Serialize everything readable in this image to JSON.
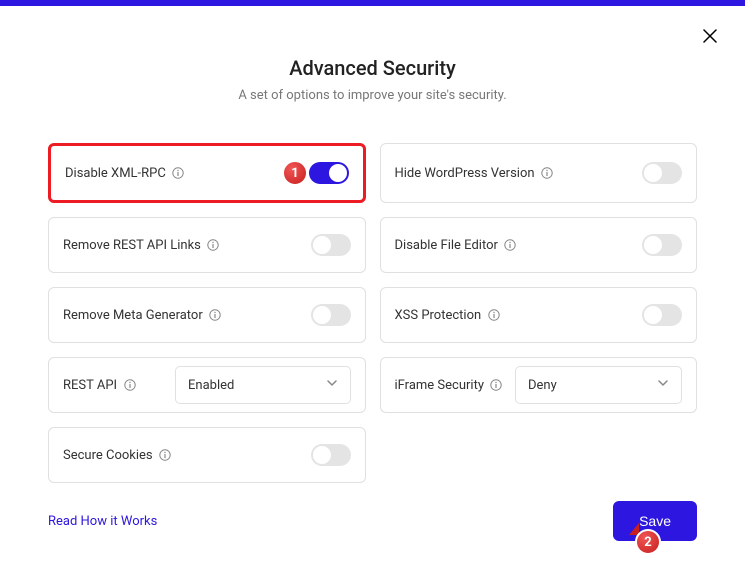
{
  "header": {
    "title": "Advanced Security",
    "subtitle": "A set of options to improve your site's security."
  },
  "options": {
    "disable_xmlrpc": {
      "label": "Disable XML-RPC",
      "on": true
    },
    "hide_wp_version": {
      "label": "Hide WordPress Version",
      "on": false
    },
    "remove_rest_links": {
      "label": "Remove REST API Links",
      "on": false
    },
    "disable_file_editor": {
      "label": "Disable File Editor",
      "on": false
    },
    "remove_meta_generator": {
      "label": "Remove Meta Generator",
      "on": false
    },
    "xss_protection": {
      "label": "XSS Protection",
      "on": false
    },
    "rest_api": {
      "label": "REST API",
      "value": "Enabled"
    },
    "iframe_security": {
      "label": "iFrame Security",
      "value": "Deny"
    },
    "secure_cookies": {
      "label": "Secure Cookies",
      "on": false
    }
  },
  "footer": {
    "help_link": "Read How it Works",
    "save_label": "Save"
  },
  "annotations": {
    "badge1": "1",
    "badge2": "2"
  }
}
